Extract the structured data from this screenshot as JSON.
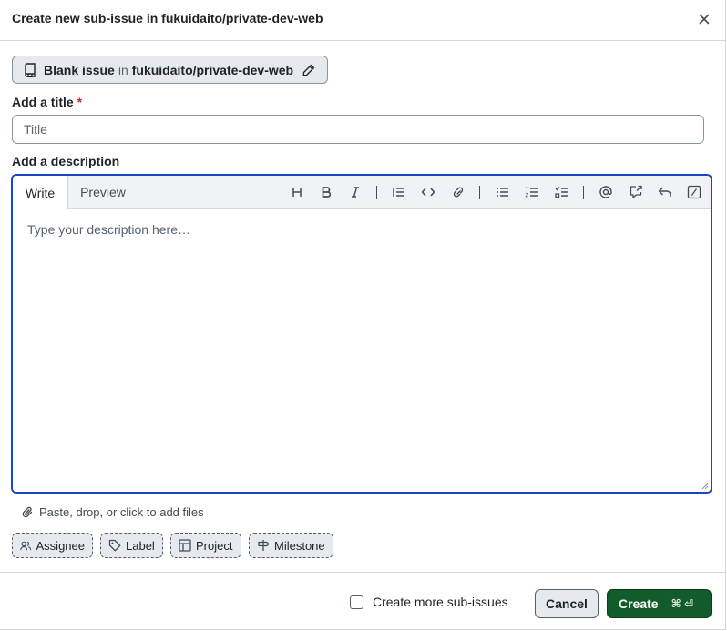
{
  "dialog": {
    "title": "Create new sub-issue in fukuidaito/private-dev-web"
  },
  "template": {
    "name": "Blank issue",
    "connector": "in",
    "repo": "fukuidaito/private-dev-web"
  },
  "title_field": {
    "label": "Add a title",
    "required_mark": "*",
    "placeholder": "Title",
    "value": ""
  },
  "description": {
    "label": "Add a description",
    "tabs": [
      {
        "label": "Write",
        "active": true
      },
      {
        "label": "Preview",
        "active": false
      }
    ],
    "placeholder": "Type your description here…",
    "value": "",
    "toolbar_icons": [
      "heading-icon",
      "bold-icon",
      "italic-icon",
      "quote-icon",
      "code-icon",
      "link-icon",
      "bullet-list-icon",
      "numbered-list-icon",
      "task-list-icon",
      "mention-icon",
      "reference-icon",
      "reply-icon",
      "slash-command-icon"
    ]
  },
  "attach": {
    "label": "Paste, drop, or click to add files"
  },
  "metadata": {
    "assignee": "Assignee",
    "label": "Label",
    "project": "Project",
    "milestone": "Milestone"
  },
  "footer": {
    "create_more_label": "Create more sub-issues",
    "create_more_checked": false,
    "cancel": "Cancel",
    "create": "Create",
    "create_shortcut": "⌘ ⏎"
  },
  "colors": {
    "accent_focus": "#1a47c8",
    "primary_button": "#115c2a",
    "required": "#d1242f",
    "border": "#d0d7de"
  }
}
